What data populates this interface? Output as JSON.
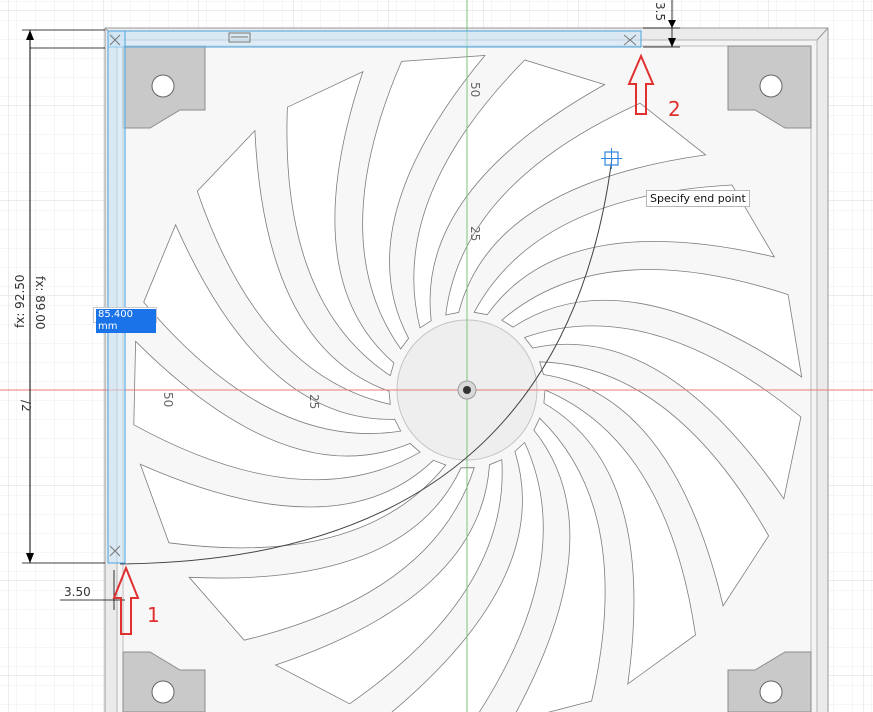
{
  "dimensions": {
    "height_driven": "fx: 92.50",
    "height_rotated": "fx: 89.00",
    "offset_bottom": "3.50",
    "offset_top": "3.5",
    "constraint_mark": "/2"
  },
  "sketch_labels": {
    "center_top": "50",
    "center_mid": "25",
    "left_far": "50",
    "left_mid": "25"
  },
  "dimension_input": {
    "value": "85.400 mm"
  },
  "tooltip": {
    "text": "Specify end point"
  },
  "annotations": {
    "arrow1_label": "1",
    "arrow2_label": "2"
  },
  "colors": {
    "selection_highlight": "#a9d3f0",
    "selection_edge": "#4aa3df",
    "annotation_red": "#e03030",
    "x_axis": "#e87a7a",
    "y_axis": "#78c878",
    "grid": "#e3e3e3",
    "input_selection": "#1a73e8"
  }
}
